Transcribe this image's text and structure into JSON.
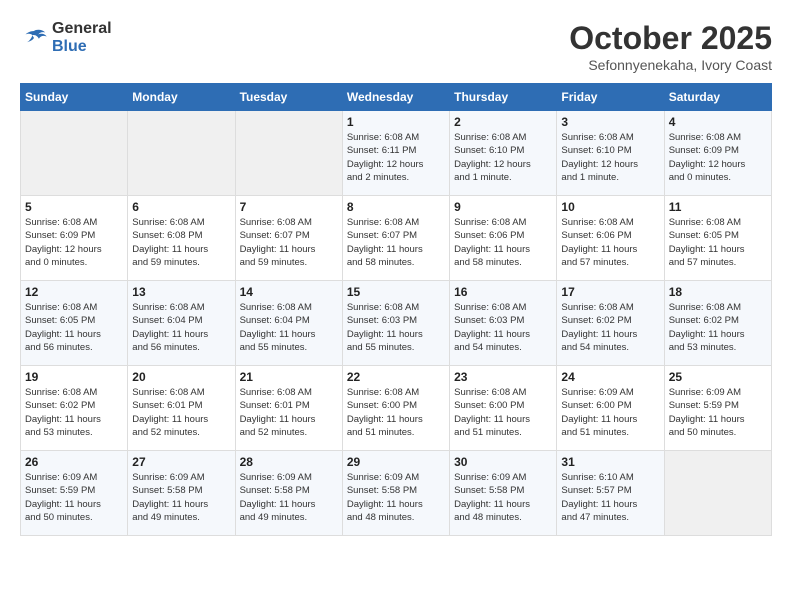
{
  "logo": {
    "general": "General",
    "blue": "Blue"
  },
  "title": "October 2025",
  "location": "Sefonnyenekaha, Ivory Coast",
  "weekdays": [
    "Sunday",
    "Monday",
    "Tuesday",
    "Wednesday",
    "Thursday",
    "Friday",
    "Saturday"
  ],
  "weeks": [
    [
      {
        "day": "",
        "info": ""
      },
      {
        "day": "",
        "info": ""
      },
      {
        "day": "",
        "info": ""
      },
      {
        "day": "1",
        "info": "Sunrise: 6:08 AM\nSunset: 6:11 PM\nDaylight: 12 hours\nand 2 minutes."
      },
      {
        "day": "2",
        "info": "Sunrise: 6:08 AM\nSunset: 6:10 PM\nDaylight: 12 hours\nand 1 minute."
      },
      {
        "day": "3",
        "info": "Sunrise: 6:08 AM\nSunset: 6:10 PM\nDaylight: 12 hours\nand 1 minute."
      },
      {
        "day": "4",
        "info": "Sunrise: 6:08 AM\nSunset: 6:09 PM\nDaylight: 12 hours\nand 0 minutes."
      }
    ],
    [
      {
        "day": "5",
        "info": "Sunrise: 6:08 AM\nSunset: 6:09 PM\nDaylight: 12 hours\nand 0 minutes."
      },
      {
        "day": "6",
        "info": "Sunrise: 6:08 AM\nSunset: 6:08 PM\nDaylight: 11 hours\nand 59 minutes."
      },
      {
        "day": "7",
        "info": "Sunrise: 6:08 AM\nSunset: 6:07 PM\nDaylight: 11 hours\nand 59 minutes."
      },
      {
        "day": "8",
        "info": "Sunrise: 6:08 AM\nSunset: 6:07 PM\nDaylight: 11 hours\nand 58 minutes."
      },
      {
        "day": "9",
        "info": "Sunrise: 6:08 AM\nSunset: 6:06 PM\nDaylight: 11 hours\nand 58 minutes."
      },
      {
        "day": "10",
        "info": "Sunrise: 6:08 AM\nSunset: 6:06 PM\nDaylight: 11 hours\nand 57 minutes."
      },
      {
        "day": "11",
        "info": "Sunrise: 6:08 AM\nSunset: 6:05 PM\nDaylight: 11 hours\nand 57 minutes."
      }
    ],
    [
      {
        "day": "12",
        "info": "Sunrise: 6:08 AM\nSunset: 6:05 PM\nDaylight: 11 hours\nand 56 minutes."
      },
      {
        "day": "13",
        "info": "Sunrise: 6:08 AM\nSunset: 6:04 PM\nDaylight: 11 hours\nand 56 minutes."
      },
      {
        "day": "14",
        "info": "Sunrise: 6:08 AM\nSunset: 6:04 PM\nDaylight: 11 hours\nand 55 minutes."
      },
      {
        "day": "15",
        "info": "Sunrise: 6:08 AM\nSunset: 6:03 PM\nDaylight: 11 hours\nand 55 minutes."
      },
      {
        "day": "16",
        "info": "Sunrise: 6:08 AM\nSunset: 6:03 PM\nDaylight: 11 hours\nand 54 minutes."
      },
      {
        "day": "17",
        "info": "Sunrise: 6:08 AM\nSunset: 6:02 PM\nDaylight: 11 hours\nand 54 minutes."
      },
      {
        "day": "18",
        "info": "Sunrise: 6:08 AM\nSunset: 6:02 PM\nDaylight: 11 hours\nand 53 minutes."
      }
    ],
    [
      {
        "day": "19",
        "info": "Sunrise: 6:08 AM\nSunset: 6:02 PM\nDaylight: 11 hours\nand 53 minutes."
      },
      {
        "day": "20",
        "info": "Sunrise: 6:08 AM\nSunset: 6:01 PM\nDaylight: 11 hours\nand 52 minutes."
      },
      {
        "day": "21",
        "info": "Sunrise: 6:08 AM\nSunset: 6:01 PM\nDaylight: 11 hours\nand 52 minutes."
      },
      {
        "day": "22",
        "info": "Sunrise: 6:08 AM\nSunset: 6:00 PM\nDaylight: 11 hours\nand 51 minutes."
      },
      {
        "day": "23",
        "info": "Sunrise: 6:08 AM\nSunset: 6:00 PM\nDaylight: 11 hours\nand 51 minutes."
      },
      {
        "day": "24",
        "info": "Sunrise: 6:09 AM\nSunset: 6:00 PM\nDaylight: 11 hours\nand 51 minutes."
      },
      {
        "day": "25",
        "info": "Sunrise: 6:09 AM\nSunset: 5:59 PM\nDaylight: 11 hours\nand 50 minutes."
      }
    ],
    [
      {
        "day": "26",
        "info": "Sunrise: 6:09 AM\nSunset: 5:59 PM\nDaylight: 11 hours\nand 50 minutes."
      },
      {
        "day": "27",
        "info": "Sunrise: 6:09 AM\nSunset: 5:58 PM\nDaylight: 11 hours\nand 49 minutes."
      },
      {
        "day": "28",
        "info": "Sunrise: 6:09 AM\nSunset: 5:58 PM\nDaylight: 11 hours\nand 49 minutes."
      },
      {
        "day": "29",
        "info": "Sunrise: 6:09 AM\nSunset: 5:58 PM\nDaylight: 11 hours\nand 48 minutes."
      },
      {
        "day": "30",
        "info": "Sunrise: 6:09 AM\nSunset: 5:58 PM\nDaylight: 11 hours\nand 48 minutes."
      },
      {
        "day": "31",
        "info": "Sunrise: 6:10 AM\nSunset: 5:57 PM\nDaylight: 11 hours\nand 47 minutes."
      },
      {
        "day": "",
        "info": ""
      }
    ]
  ]
}
